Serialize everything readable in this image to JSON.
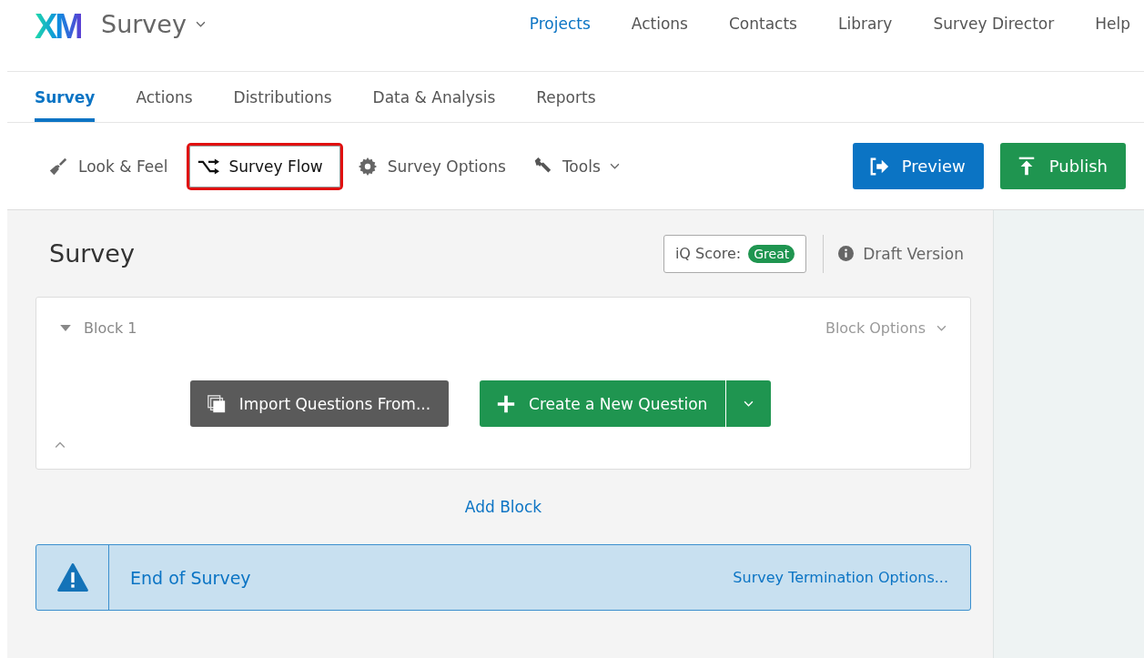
{
  "header": {
    "logo": "XM",
    "product": "Survey",
    "nav": [
      {
        "label": "Projects",
        "selected": true
      },
      {
        "label": "Actions",
        "selected": false
      },
      {
        "label": "Contacts",
        "selected": false
      },
      {
        "label": "Library",
        "selected": false
      },
      {
        "label": "Survey Director",
        "selected": false
      },
      {
        "label": "Help",
        "selected": false
      }
    ]
  },
  "tabs": [
    {
      "label": "Survey",
      "selected": true
    },
    {
      "label": "Actions",
      "selected": false
    },
    {
      "label": "Distributions",
      "selected": false
    },
    {
      "label": "Data & Analysis",
      "selected": false
    },
    {
      "label": "Reports",
      "selected": false
    }
  ],
  "toolbar": {
    "tools": [
      {
        "label": "Look & Feel",
        "kind": "brush",
        "highlighted": false
      },
      {
        "label": "Survey Flow",
        "kind": "flow",
        "highlighted": true
      },
      {
        "label": "Survey Options",
        "kind": "gear",
        "highlighted": false
      },
      {
        "label": "Tools",
        "kind": "wrench",
        "highlighted": false
      }
    ],
    "actions": [
      {
        "label": "Preview",
        "kind": "preview"
      },
      {
        "label": "Publish",
        "kind": "publish"
      }
    ]
  },
  "survey": {
    "title": "Survey",
    "iq_score_label": "iQ Score:",
    "iq_score": "Great",
    "version": "Draft Version",
    "block": {
      "name": "Block 1",
      "expanded": true,
      "options": "Block Options",
      "import_button": "Import Questions From...",
      "create_button": "Create a New Question"
    },
    "add_block": "Add Block",
    "end": {
      "label": "End of Survey",
      "options": "Survey Termination Options..."
    }
  }
}
